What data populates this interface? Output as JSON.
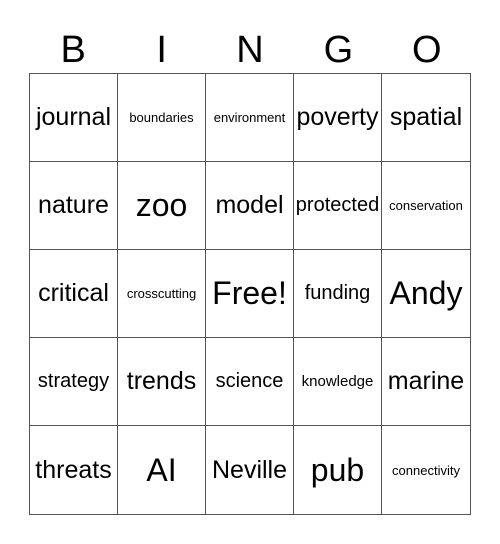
{
  "header": [
    "B",
    "I",
    "N",
    "G",
    "O"
  ],
  "cells": [
    {
      "text": "journal",
      "size": "lg"
    },
    {
      "text": "boundaries",
      "size": "xs"
    },
    {
      "text": "environment",
      "size": "xs"
    },
    {
      "text": "poverty",
      "size": "lg"
    },
    {
      "text": "spatial",
      "size": "lg"
    },
    {
      "text": "nature",
      "size": "lg"
    },
    {
      "text": "zoo",
      "size": "xl"
    },
    {
      "text": "model",
      "size": "lg"
    },
    {
      "text": "protected",
      "size": "md"
    },
    {
      "text": "conservation",
      "size": "xs"
    },
    {
      "text": "critical",
      "size": "lg"
    },
    {
      "text": "crosscutting",
      "size": "xs"
    },
    {
      "text": "Free!",
      "size": "xl"
    },
    {
      "text": "funding",
      "size": "md"
    },
    {
      "text": "Andy",
      "size": "xl"
    },
    {
      "text": "strategy",
      "size": "md"
    },
    {
      "text": "trends",
      "size": "lg"
    },
    {
      "text": "science",
      "size": "md"
    },
    {
      "text": "knowledge",
      "size": "sm"
    },
    {
      "text": "marine",
      "size": "lg"
    },
    {
      "text": "threats",
      "size": "lg"
    },
    {
      "text": "AI",
      "size": "xl"
    },
    {
      "text": "Neville",
      "size": "lg"
    },
    {
      "text": "pub",
      "size": "xl"
    },
    {
      "text": "connectivity",
      "size": "xs"
    }
  ]
}
